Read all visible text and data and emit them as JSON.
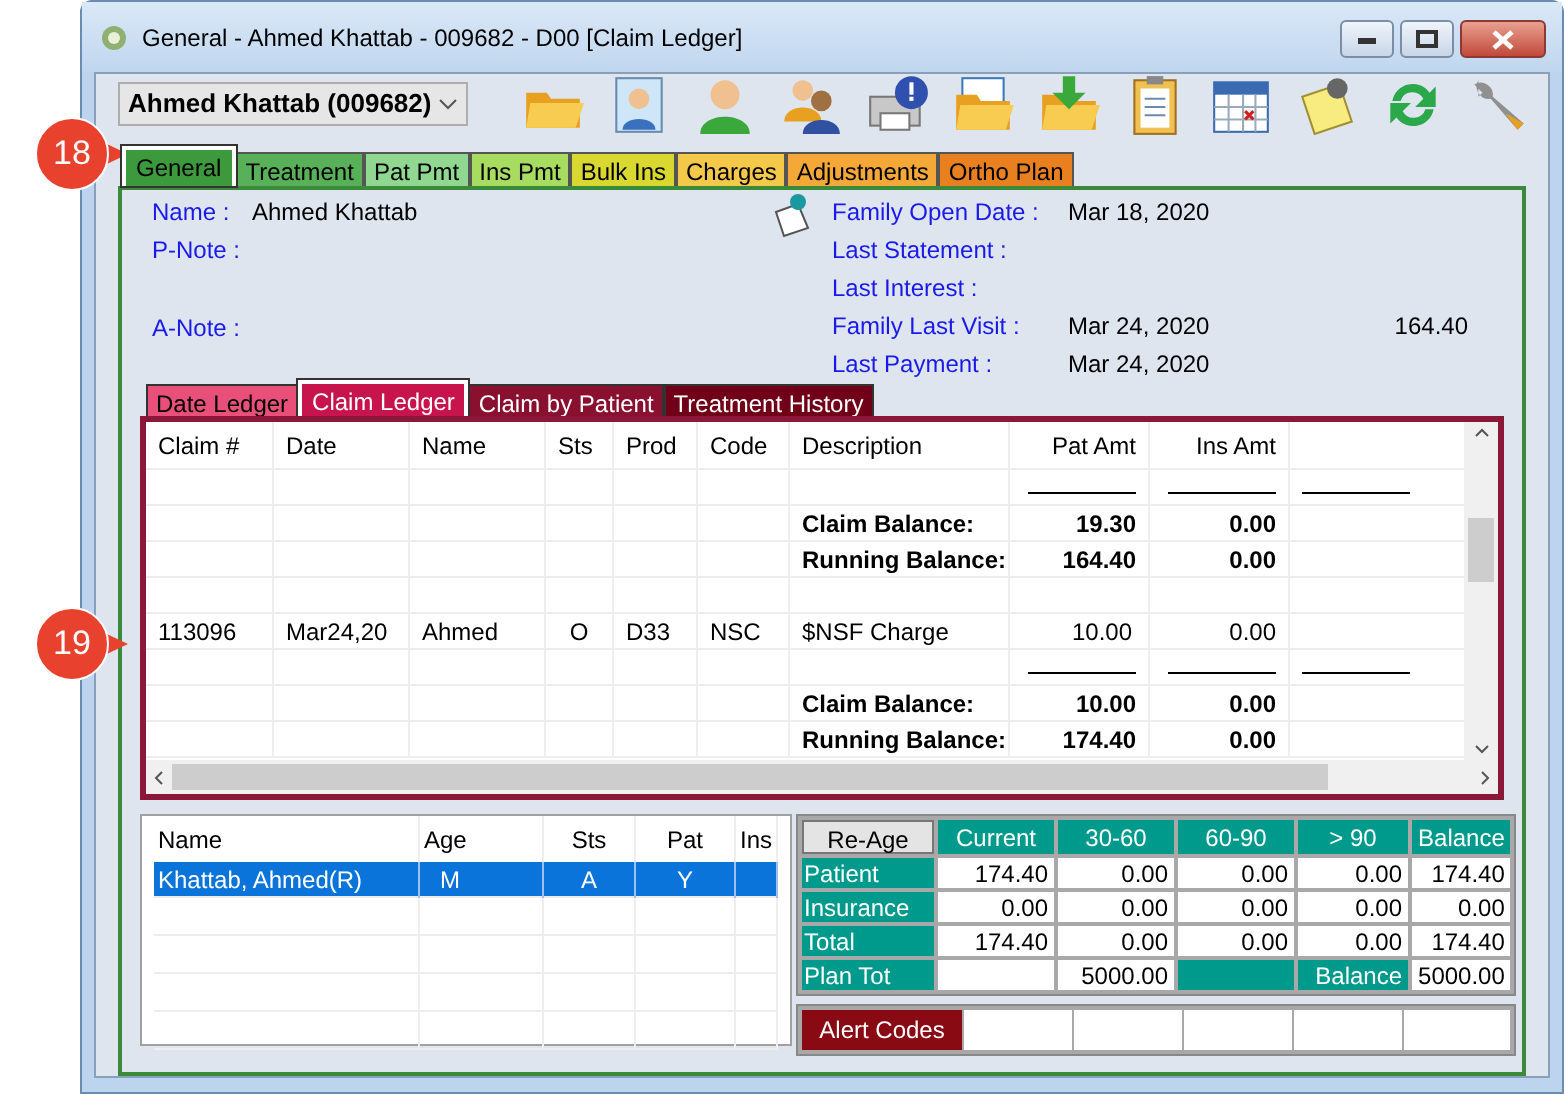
{
  "callouts": [
    {
      "label": "18"
    },
    {
      "label": "19"
    }
  ],
  "window": {
    "title": "General - Ahmed Khattab - 009682 - D00 [Claim Ledger]"
  },
  "patient_select": {
    "value": "Ahmed Khattab (009682)"
  },
  "tabs": [
    {
      "label": "General",
      "selected": true,
      "color": "#3c9a3c"
    },
    {
      "label": "Treatment",
      "selected": false,
      "color": "#58b058"
    },
    {
      "label": "Pat Pmt",
      "selected": false,
      "color": "#90d890"
    },
    {
      "label": "Ins Pmt",
      "selected": false,
      "color": "#a8dc60"
    },
    {
      "label": "Bulk Ins",
      "selected": false,
      "color": "#d8d830"
    },
    {
      "label": "Charges",
      "selected": false,
      "color": "#f4c848"
    },
    {
      "label": "Adjustments",
      "selected": false,
      "color": "#f4a838"
    },
    {
      "label": "Ortho Plan",
      "selected": false,
      "color": "#e88020"
    }
  ],
  "info_left": [
    {
      "label": "Name :",
      "value": "Ahmed Khattab"
    },
    {
      "label": "P-Note :"
    },
    {
      "label": "A-Note :"
    }
  ],
  "info_right": [
    {
      "label": "Family Open Date :",
      "value": "Mar 18, 2020"
    },
    {
      "label": "Last Statement :"
    },
    {
      "label": "Last Interest :"
    },
    {
      "label": "Family Last Visit :",
      "value": "Mar 24, 2020",
      "amount": "164.40"
    },
    {
      "label": "Last Payment :",
      "value": "Mar 24, 2020"
    }
  ],
  "ledger_tabs": [
    {
      "label": "Date Ledger",
      "selected": false,
      "color": "#e8507a"
    },
    {
      "label": "Claim Ledger",
      "selected": true,
      "color": "#c8144c"
    },
    {
      "label": "Claim by Patient",
      "selected": false,
      "color": "#8a1030"
    },
    {
      "label": "Treatment History",
      "selected": false,
      "color": "#700018"
    }
  ],
  "ledger": {
    "columns": [
      "Claim #",
      "Date",
      "Name",
      "Sts",
      "Prod",
      "Code",
      "Description",
      "Pat Amt",
      "Ins Amt"
    ],
    "rows": [
      {
        "kind": "rule"
      },
      {
        "kind": "summary",
        "label": "Claim Balance:",
        "pat_amt": "19.30",
        "ins_amt": "0.00"
      },
      {
        "kind": "summary",
        "label": "Running Balance:",
        "pat_amt": "164.40",
        "ins_amt": "0.00"
      },
      {
        "kind": "blank"
      },
      {
        "kind": "entry",
        "cells": [
          "113096",
          "Mar24,20",
          "Ahmed",
          "O",
          "D33",
          "NSC",
          "$NSF Charge"
        ],
        "pat_amt": "10.00",
        "ins_amt": "0.00"
      },
      {
        "kind": "rule"
      },
      {
        "kind": "summary",
        "label": "Claim Balance:",
        "pat_amt": "10.00",
        "ins_amt": "0.00"
      },
      {
        "kind": "summary",
        "label": "Running Balance:",
        "pat_amt": "174.40",
        "ins_amt": "0.00"
      }
    ]
  },
  "family": {
    "columns": [
      "Name",
      "Age",
      "Sts",
      "Pat",
      "Ins"
    ],
    "rows": [
      {
        "cells": [
          "Khattab, Ahmed(R)",
          "M",
          "A",
          "Y",
          ""
        ],
        "selected": true
      }
    ]
  },
  "aging": {
    "button": "Re-Age",
    "columns": [
      "Current",
      "30-60",
      "60-90",
      "> 90",
      "Balance"
    ],
    "rows": [
      {
        "label": "Patient",
        "values": [
          "174.40",
          "0.00",
          "0.00",
          "0.00",
          "174.40"
        ]
      },
      {
        "label": "Insurance",
        "values": [
          "0.00",
          "0.00",
          "0.00",
          "0.00",
          "0.00"
        ]
      },
      {
        "label": "Total",
        "values": [
          "174.40",
          "0.00",
          "0.00",
          "0.00",
          "174.40"
        ]
      }
    ],
    "plan": {
      "label": "Plan Tot",
      "value": "5000.00",
      "balance_label": "Balance",
      "balance": "5000.00"
    }
  },
  "alert": {
    "button": "Alert Codes"
  }
}
